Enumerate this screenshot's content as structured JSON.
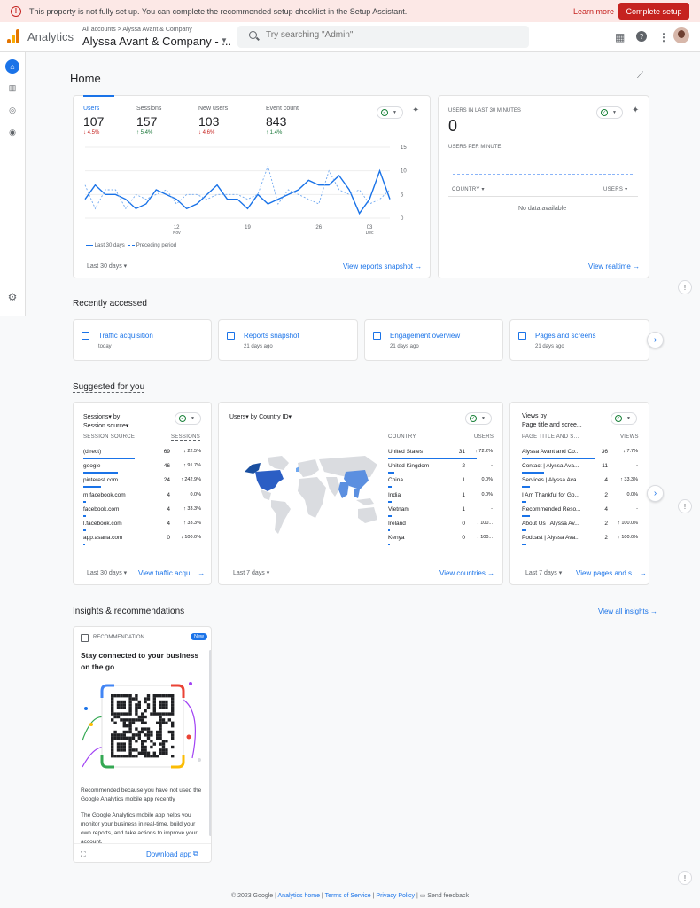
{
  "banner": {
    "message": "This property is not fully set up. You can complete the recommended setup checklist in the Setup Assistant.",
    "learn_more": "Learn more",
    "cta": "Complete setup"
  },
  "header": {
    "app_name": "Analytics",
    "account_path": "All accounts > Alyssa Avant & Company",
    "account_name": "Alyssa Avant & Company - ...",
    "search_placeholder": "Try searching \"Admin\""
  },
  "home": {
    "title": "Home",
    "metrics": [
      {
        "label": "Users",
        "value": "107",
        "change": "↓ 4.5%",
        "dir": "down"
      },
      {
        "label": "Sessions",
        "value": "157",
        "change": "↑ 5.4%",
        "dir": "up"
      },
      {
        "label": "New users",
        "value": "103",
        "change": "↓ 4.6%",
        "dir": "down"
      },
      {
        "label": "Event count",
        "value": "843",
        "change": "↑ 1.4%",
        "dir": "up"
      }
    ],
    "legend_current": "Last 30 days",
    "legend_previous": "Preceding period",
    "date_range": "Last 30 days",
    "view_link": "View reports snapshot →"
  },
  "chart_data": {
    "type": "line",
    "x_tick_labels": [
      "12\nNov",
      "19",
      "26",
      "03\nDec"
    ],
    "yticks": [
      0,
      5,
      10,
      15
    ],
    "ylim": [
      0,
      15
    ],
    "series": [
      {
        "name": "Last 30 days",
        "values": [
          4,
          7,
          5,
          5,
          4,
          2,
          3,
          6,
          5,
          4,
          2,
          3,
          5,
          7,
          4,
          4,
          2,
          5,
          3,
          4,
          5,
          6,
          8,
          7,
          7,
          9,
          6,
          1,
          4,
          10,
          4
        ]
      },
      {
        "name": "Preceding period",
        "values": [
          7,
          2,
          6,
          6,
          2,
          5,
          4,
          5,
          6,
          3,
          5,
          5,
          4,
          5,
          5,
          5,
          4,
          5,
          11,
          3,
          6,
          5,
          4,
          3,
          10,
          6,
          5,
          6,
          3,
          4,
          6
        ]
      }
    ],
    "grid": true
  },
  "realtime": {
    "title": "USERS IN LAST 30 MINUTES",
    "value": "0",
    "per_minute": "USERS PER MINUTE",
    "col_country": "COUNTRY",
    "col_users": "USERS",
    "empty": "No data available",
    "view_link": "View realtime →"
  },
  "recent": {
    "title": "Recently accessed",
    "items": [
      {
        "label": "Traffic acquisition",
        "date": "today"
      },
      {
        "label": "Reports snapshot",
        "date": "21 days ago"
      },
      {
        "label": "Engagement overview",
        "date": "21 days ago"
      },
      {
        "label": "Pages and screens",
        "date": "21 days ago"
      }
    ]
  },
  "suggested": {
    "title": "Suggested for you",
    "sessions": {
      "title_line1": "Sessions▾ by",
      "title_line2": "Session source▾",
      "col1": "SESSION SOURCE",
      "col2": "SESSIONS",
      "rows": [
        {
          "name": "(direct)",
          "value": "69",
          "change": "↓ 22.5%",
          "dir": "down",
          "fill": 1.0
        },
        {
          "name": "google",
          "value": "46",
          "change": "↑ 91.7%",
          "dir": "up",
          "fill": 0.67
        },
        {
          "name": "pinterest.com",
          "value": "24",
          "change": "↑ 242.9%",
          "dir": "up",
          "fill": 0.35
        },
        {
          "name": "m.facebook.com",
          "value": "4",
          "change": "0.0%",
          "dir": "flat",
          "fill": 0.06
        },
        {
          "name": "facebook.com",
          "value": "4",
          "change": "↑ 33.3%",
          "dir": "up",
          "fill": 0.06
        },
        {
          "name": "l.facebook.com",
          "value": "4",
          "change": "↑ 33.3%",
          "dir": "up",
          "fill": 0.06
        },
        {
          "name": "app.asana.com",
          "value": "0",
          "change": "↓ 100.0%",
          "dir": "down",
          "fill": 0.0
        }
      ],
      "date_range": "Last 30 days",
      "view_link": "View traffic acqu... →"
    },
    "country": {
      "title": "Users▾ by Country ID▾",
      "col1": "COUNTRY",
      "col2": "USERS",
      "rows": [
        {
          "name": "United States",
          "value": "31",
          "change": "↑ 72.2%",
          "dir": "up",
          "fill": 1.0
        },
        {
          "name": "United Kingdom",
          "value": "2",
          "change": "-",
          "dir": "flat",
          "fill": 0.07
        },
        {
          "name": "China",
          "value": "1",
          "change": "0.0%",
          "dir": "flat",
          "fill": 0.04
        },
        {
          "name": "India",
          "value": "1",
          "change": "0.0%",
          "dir": "flat",
          "fill": 0.04
        },
        {
          "name": "Vietnam",
          "value": "1",
          "change": "-",
          "dir": "flat",
          "fill": 0.04
        },
        {
          "name": "Ireland",
          "value": "0",
          "change": "↓ 100...",
          "dir": "down",
          "fill": 0.0
        },
        {
          "name": "Kenya",
          "value": "0",
          "change": "↓ 100...",
          "dir": "down",
          "fill": 0.0
        }
      ],
      "date_range": "Last 7 days",
      "view_link": "View countries →"
    },
    "pages": {
      "title_line1": "Views by",
      "title_line2": "Page title and scree...",
      "col1": "PAGE TITLE AND S...",
      "col2": "VIEWS",
      "rows": [
        {
          "name": "Alyssa Avant and Co...",
          "value": "36",
          "change": "↓ 7.7%",
          "dir": "down",
          "fill": 1.0
        },
        {
          "name": "Contact | Alyssa Ava...",
          "value": "11",
          "change": "-",
          "dir": "flat",
          "fill": 0.3
        },
        {
          "name": "Services | Alyssa Ava...",
          "value": "4",
          "change": "↑ 33.3%",
          "dir": "up",
          "fill": 0.11
        },
        {
          "name": "I Am Thankful for Go...",
          "value": "2",
          "change": "0.0%",
          "dir": "flat",
          "fill": 0.06
        },
        {
          "name": "Recommended Reso...",
          "value": "4",
          "change": "-",
          "dir": "flat",
          "fill": 0.11
        },
        {
          "name": "About Us | Alyssa Av...",
          "value": "2",
          "change": "↑ 100.0%",
          "dir": "up",
          "fill": 0.06
        },
        {
          "name": "Podcast | Alyssa Ava...",
          "value": "2",
          "change": "↑ 100.0%",
          "dir": "up",
          "fill": 0.06
        }
      ],
      "date_range": "Last 7 days",
      "view_link": "View pages and s... →"
    }
  },
  "insights": {
    "title": "Insights & recommendations",
    "view_all": "View all insights →",
    "rec_label": "RECOMMENDATION",
    "badge": "New",
    "heading": "Stay connected to your business on the go",
    "reason": "Recommended because you have not used the Google Analytics mobile app recently",
    "body": "The Google Analytics mobile app helps you monitor your business in real-time, build your own reports, and take actions to improve your account.",
    "download": "Download app"
  },
  "footer": {
    "copyright": "© 2023 Google |",
    "home": "Analytics home",
    "terms": "Terms of Service",
    "privacy": "Privacy Policy",
    "feedback": "Send feedback"
  }
}
